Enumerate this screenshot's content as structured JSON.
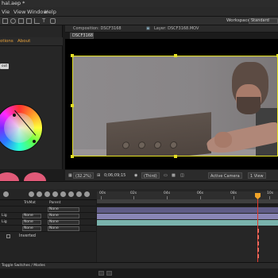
{
  "app": {
    "title": "hal.aep *"
  },
  "menu": [
    "Vie",
    "View",
    "Window",
    "Help"
  ],
  "workspace": {
    "label": "Workspace:",
    "value": "Standard"
  },
  "left_panel": {
    "tabs": [
      "otions",
      "About"
    ],
    "button_label": "out"
  },
  "composition": {
    "header_text": "Composition: DSCF3168",
    "layer_text": "Layer: DSCF3168.MOV",
    "tab": "DSCF3168"
  },
  "viewer_controls": {
    "zoom": "(32.2%)",
    "timecode": "0;06;09;15",
    "resolution": "(Third)",
    "view": "Active Camera",
    "views": "1 View"
  },
  "timeline": {
    "ruler_labels": [
      "00s",
      "02s",
      "04s",
      "06s",
      "08s",
      "10s"
    ],
    "column_headers": [
      "TrkMat",
      "Parent"
    ],
    "layers": [
      {
        "num": "",
        "trkmat": "",
        "parent": "None"
      },
      {
        "num": "Lig",
        "trkmat": "None",
        "parent": "None"
      },
      {
        "num": "Lig",
        "trkmat": "None",
        "parent": "None"
      },
      {
        "num": "",
        "trkmat": "None",
        "parent": "None"
      }
    ],
    "inverted_label": "Inverted",
    "footer": "Toggle Switches / Modes"
  },
  "colors": {
    "accent": "#e9a23b",
    "selection": "#e4e024",
    "playhead": "#e23a2e",
    "layer_bar_purple": "#8a86b6",
    "layer_bar_teal": "#7ab3ad"
  }
}
